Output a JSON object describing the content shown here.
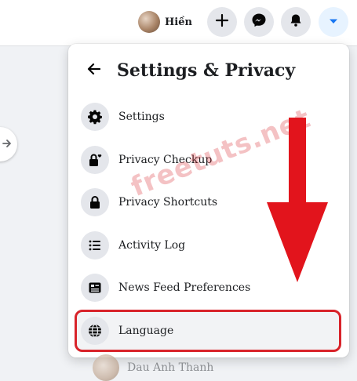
{
  "topbar": {
    "profile_name": "Hiền",
    "buttons": [
      {
        "icon": "plus-icon"
      },
      {
        "icon": "messenger-icon"
      },
      {
        "icon": "bell-icon"
      },
      {
        "icon": "caret-down-icon",
        "active": true
      }
    ]
  },
  "panel": {
    "title": "Settings & Privacy",
    "items": [
      {
        "label": "Settings",
        "icon": "gear-icon"
      },
      {
        "label": "Privacy Checkup",
        "icon": "lock-heart-icon"
      },
      {
        "label": "Privacy Shortcuts",
        "icon": "lock-icon"
      },
      {
        "label": "Activity Log",
        "icon": "list-icon"
      },
      {
        "label": "News Feed Preferences",
        "icon": "newsfeed-icon"
      },
      {
        "label": "Language",
        "icon": "globe-icon",
        "highlighted": true
      }
    ]
  },
  "below": {
    "name": "Dau Anh Thanh"
  },
  "watermark": "freetuts.net",
  "colors": {
    "accent": "#1877f2",
    "highlight_border": "#d8232a",
    "arrow": "#e2141c"
  }
}
